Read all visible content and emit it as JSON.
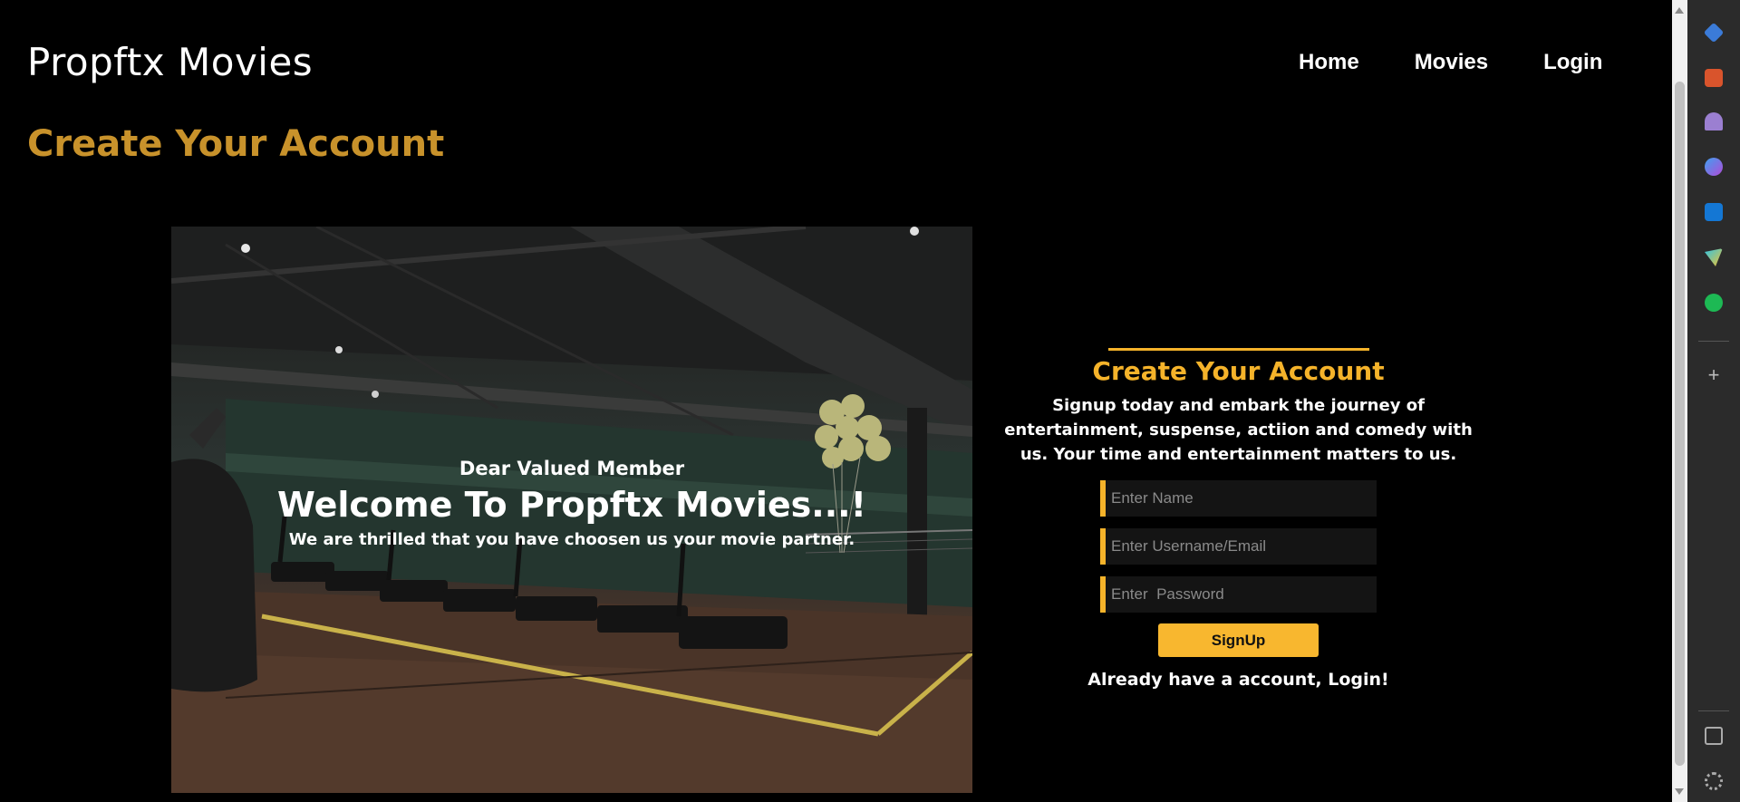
{
  "header": {
    "brand": "Propftx Movies",
    "nav": [
      "Home",
      "Movies",
      "Login"
    ]
  },
  "page_title": "Create Your Account",
  "hero": {
    "greeting": "Dear Valued Member",
    "welcome": "Welcome To Propftx Movies...!",
    "subtitle": "We are thrilled that you have choosen us your movie partner."
  },
  "signup": {
    "title": "Create Your Account",
    "description": "Signup today and embark the journey of entertainment, suspense, actiion and comedy with us. Your time and entertainment matters to us.",
    "name_placeholder": "Enter Name",
    "username_placeholder": "Enter Username/Email",
    "password_placeholder": "Enter  Password",
    "button_label": "SignUp",
    "login_prompt": "Already have a account, Login!"
  },
  "colors": {
    "accent": "#f5b32a",
    "title_gold": "#c8922b",
    "background": "#000000"
  },
  "sidebar_icons": [
    "tag-icon",
    "toolbox-icon",
    "chess-icon",
    "copilot-icon",
    "outlook-icon",
    "send-icon",
    "spotify-icon",
    "add-icon",
    "split-view-icon",
    "settings-icon"
  ]
}
